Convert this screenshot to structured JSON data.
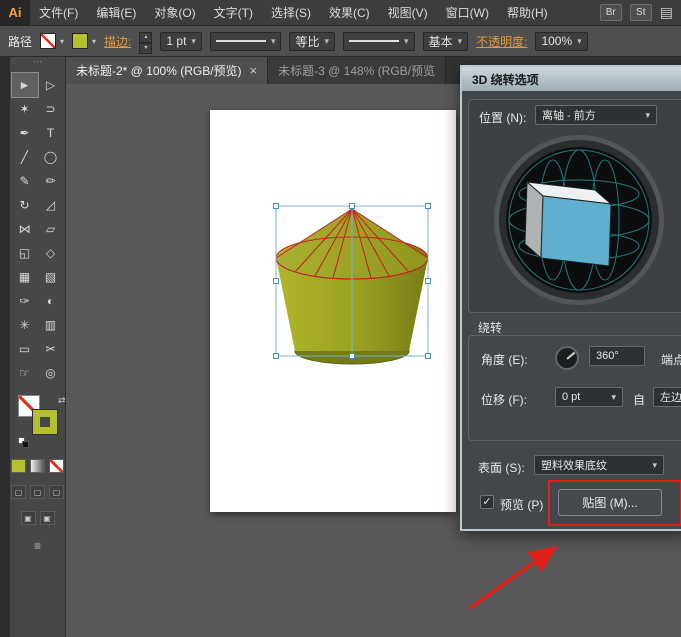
{
  "colors": {
    "shape_olive": "#9aa21f",
    "wireframe_red": "#c81e1e",
    "selection_blue": "#74b6d8",
    "cube_front": "#5fb0cf",
    "cube_top": "#eef0f1",
    "cube_left": "#aeb2b3",
    "grid_teal": "#2c8b8b",
    "annotation_red": "#df2118",
    "accent_orange": "#e09a3f"
  },
  "icons": {
    "chevron_down": "▾",
    "stepper_up": "▴",
    "stepper_down": "▾",
    "check": "✓",
    "swap": "⇄",
    "grip_dots": "⋯",
    "grip_lines": "≡",
    "workspace": "▤",
    "draw_mode": "▢",
    "screen_mode": "▣"
  },
  "menubar": {
    "logo": "Ai",
    "items": [
      {
        "label": "文件(F)"
      },
      {
        "label": "编辑(E)"
      },
      {
        "label": "对象(O)"
      },
      {
        "label": "文字(T)"
      },
      {
        "label": "选择(S)"
      },
      {
        "label": "效果(C)"
      },
      {
        "label": "视图(V)"
      },
      {
        "label": "窗口(W)"
      },
      {
        "label": "帮助(H)"
      }
    ],
    "right_buttons": [
      {
        "label": "Br"
      },
      {
        "label": "St"
      }
    ]
  },
  "control_bar": {
    "context_label": "路径",
    "stroke_label": "描边:",
    "stroke_value": "1 pt",
    "profile_value": "等比",
    "brush_value": "基本",
    "opacity_label": "不透明度:",
    "opacity_value": "100%"
  },
  "tabs": [
    {
      "label": "未标题-2* @ 100% (RGB/预览)",
      "close": "×"
    },
    {
      "label": "未标题-3 @ 148% (RGB/预览"
    }
  ],
  "tools": [
    {
      "name": "selection-tool",
      "glyph": "►"
    },
    {
      "name": "direct-selection-tool",
      "glyph": "▷"
    },
    {
      "name": "magic-wand-tool",
      "glyph": "✶"
    },
    {
      "name": "lasso-tool",
      "glyph": "⊃"
    },
    {
      "name": "pen-tool",
      "glyph": "✒"
    },
    {
      "name": "type-tool",
      "glyph": "T"
    },
    {
      "name": "line-segment-tool",
      "glyph": "╱"
    },
    {
      "name": "ellipse-tool",
      "glyph": "◯"
    },
    {
      "name": "paintbrush-tool",
      "glyph": "✎"
    },
    {
      "name": "pencil-tool",
      "glyph": "✏"
    },
    {
      "name": "rotate-tool",
      "glyph": "↻"
    },
    {
      "name": "scale-tool",
      "glyph": "◿"
    },
    {
      "name": "width-tool",
      "glyph": "⋈"
    },
    {
      "name": "free-transform-tool",
      "glyph": "▱"
    },
    {
      "name": "shape-builder-tool",
      "glyph": "◱"
    },
    {
      "name": "perspective-grid-tool",
      "glyph": "◇"
    },
    {
      "name": "mesh-tool",
      "glyph": "▦"
    },
    {
      "name": "gradient-tool",
      "glyph": "▧"
    },
    {
      "name": "eyedropper-tool",
      "glyph": "✑"
    },
    {
      "name": "blend-tool",
      "glyph": "◐"
    },
    {
      "name": "symbol-sprayer-tool",
      "glyph": "✳"
    },
    {
      "name": "column-graph-tool",
      "glyph": "▥"
    },
    {
      "name": "artboard-tool",
      "glyph": "▭"
    },
    {
      "name": "slice-tool",
      "glyph": "✂"
    },
    {
      "name": "hand-tool",
      "glyph": "☞"
    },
    {
      "name": "zoom-tool",
      "glyph": "◎"
    }
  ],
  "dialog": {
    "title": "3D 绕转选项",
    "position": {
      "label": "位置 (N):",
      "value": "离轴 - 前方"
    },
    "revolve": {
      "group_label": "绕转",
      "angle_label": "角度 (E):",
      "angle_value": "360°",
      "cap_label": "端点",
      "offset_label": "位移 (F):",
      "offset_value": "0 pt",
      "from_label": "自",
      "from_value": "左边"
    },
    "surface": {
      "label": "表面 (S):",
      "value": "塑料效果底纹"
    },
    "preview_label": "预览 (P)",
    "map_button_label": "贴图 (M)..."
  }
}
